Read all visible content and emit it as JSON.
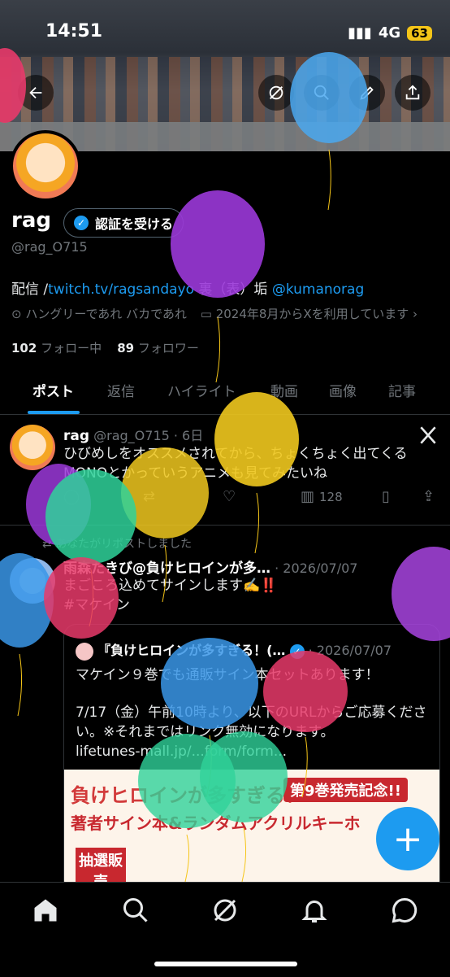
{
  "status": {
    "time": "14:51",
    "network": "4G",
    "battery": "63"
  },
  "profile": {
    "name": "rag",
    "verify_label": "認証を受ける",
    "handle": "@rag_O715",
    "bio_prefix": "配信 /",
    "bio_link": "twitch.tv/ragsandayo",
    "bio_mid": " 裏（表）垢 ",
    "bio_mention": "@kumanorag",
    "location": "ハングリーであれ バカであれ",
    "joined": "2024年8月からXを利用しています",
    "following_count": "102",
    "following_label": "フォロー中",
    "followers_count": "89",
    "followers_label": "フォロワー"
  },
  "tabs": [
    "ポスト",
    "返信",
    "ハイライト",
    "動画",
    "画像",
    "記事"
  ],
  "tweet1": {
    "name": "rag",
    "handle": "@rag_O715 · 6日",
    "text": "ひびめしをオススメされてから、ちょくちょく出てくるMONOとかっていうアニメも見てみたいね",
    "views": "128"
  },
  "tweet2": {
    "repost_label": "あなたがリポストしました",
    "name": "雨森たきび@負けヒロインが多…",
    "date": "· 2026/07/07",
    "text": "まごころ込めてサインします✍️‼️",
    "hashtag": "#マケイン",
    "quote": {
      "name": "『負けヒロインが多すぎる！(…",
      "date": "· 2026/07/07",
      "line1": "マケイン９巻でも通販サイン本セットあります！",
      "line2": "7/17（金）午前10時より、以下のURLからご応募ください。※それまではリンク無効になります。",
      "link": "lifetunes-mall.jp/...form/form...",
      "promo_title": "負けヒロインが多すぎる！",
      "promo_badge": "第9巻発売記念!!",
      "promo_sub": "著者サイン本&ランダムアクリルキーホ",
      "promo_lottery": "抽選販売"
    }
  },
  "icons": {
    "back": "back-arrow-icon",
    "grok": "grok-icon",
    "search": "search-icon",
    "edit": "edit-icon",
    "share": "share-icon",
    "home": "home-icon",
    "notifications": "bell-icon",
    "messages": "messages-icon",
    "x_logo": "x-logo-icon",
    "compose": "plus-icon"
  },
  "colors": {
    "accent": "#1d9bf0",
    "background": "#000000",
    "text": "#e7e9ea",
    "muted": "#71767b"
  }
}
